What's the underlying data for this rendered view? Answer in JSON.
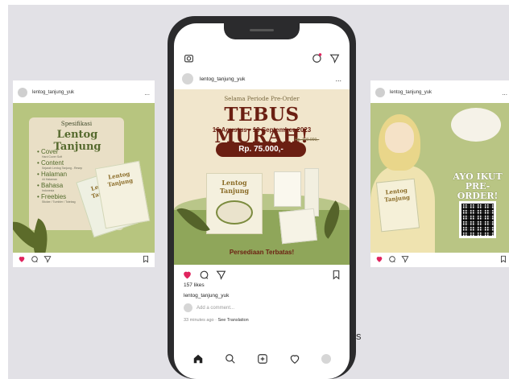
{
  "left_post": {
    "username": "lentog_tanjung_yuk",
    "more": "...",
    "spec_label": "Spesifikasi",
    "title": "Lentog Tanjung",
    "items": [
      {
        "label": "Cover",
        "sub": "Hard Cover Soft"
      },
      {
        "label": "Content",
        "sub": "Sejarah Lentog Tanjung - Resep"
      },
      {
        "label": "Halaman",
        "sub": "44 Halaman"
      },
      {
        "label": "Bahasa",
        "sub": "Indonesia"
      },
      {
        "label": "Freebies",
        "sub": "Sticker / Tumbler / Totebag"
      }
    ],
    "book_label": "Lentog Tanjung"
  },
  "phone": {
    "username": "lentog_tanjung_yuk",
    "more": "...",
    "post": {
      "subtitle": "Selama Periode Pre-Order",
      "headline": "TEBUS MURAH!",
      "dates": "16 Agustus - 10 September 2023",
      "price": "Rp. 75.000,-",
      "old_price": "Rp. 100.000,-",
      "book_label": "Lentog Tanjung",
      "footer": "Persediaan Terbatas!"
    },
    "likes": "157 likes",
    "caption": "lentog_tanjung_yuk",
    "comment_placeholder": "Add a comment...",
    "time_ago": "33 minutes ago",
    "see_translation": "See Translation"
  },
  "right_post": {
    "username": "lentog_tanjung_yuk",
    "more": "...",
    "cta": "AYO IKUT PRE-ORDER!",
    "book_label": "Lentog Tanjung"
  },
  "stray_text": "s",
  "colors": {
    "heart": "#e0245e",
    "brand_red": "#6b1f12",
    "olive": "#566a2e"
  }
}
